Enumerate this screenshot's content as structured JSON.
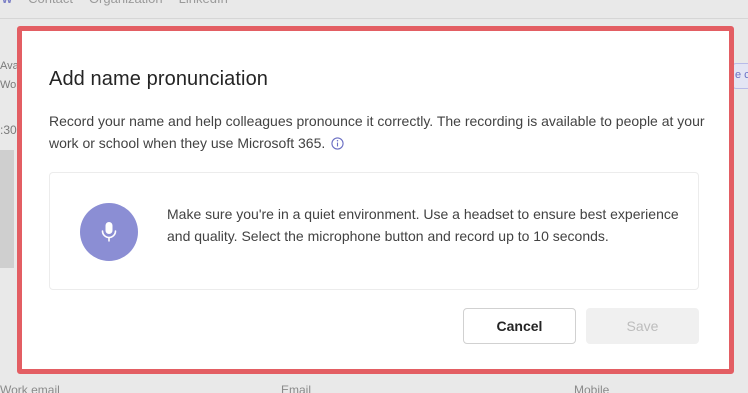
{
  "background": {
    "tabs": [
      {
        "label": "w",
        "active": true
      },
      {
        "label": "Contact",
        "active": false
      },
      {
        "label": "Organization",
        "active": false
      },
      {
        "label": "LinkedIn",
        "active": false
      }
    ],
    "left_fragments": {
      "avail": "Avai",
      "work": "Wor",
      "time": ":30"
    },
    "right_fragment": "e c",
    "bottom_labels": {
      "work_email": "Work email",
      "email": "Email",
      "mobile": "Mobile"
    }
  },
  "dialog": {
    "title": "Add name pronunciation",
    "description": "Record your name and help colleagues pronounce it correctly. The recording is available to people at your work or school when they use Microsoft 365.",
    "info_icon": "info-icon",
    "record_card": {
      "mic_icon": "microphone-icon",
      "instructions": "Make sure you're in a quiet environment. Use a headset to ensure best experience and quality. Select the microphone button and record up to 10 seconds."
    },
    "buttons": {
      "cancel_label": "Cancel",
      "save_label": "Save",
      "save_enabled": false
    }
  },
  "colors": {
    "highlight_border": "#e35e63",
    "mic_button": "#8b8ed4",
    "accent": "#6b6fc3"
  }
}
